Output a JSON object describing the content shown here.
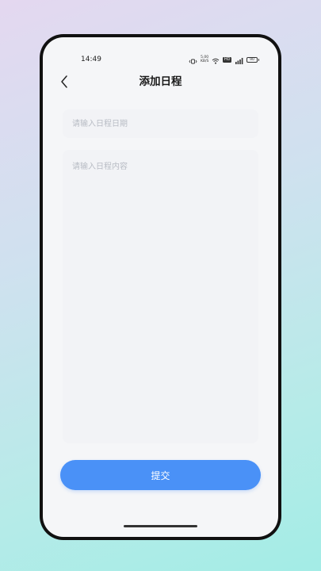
{
  "status_bar": {
    "time": "14:49",
    "net_speed_value": "5.00",
    "net_speed_unit": "KB/S",
    "hd_label": "HD",
    "battery_level": "90",
    "icons": [
      "vibrate-icon",
      "wifi-icon",
      "hd-icon",
      "signal-icon",
      "battery-icon"
    ]
  },
  "header": {
    "title": "添加日程",
    "back_icon": "chevron-left-icon"
  },
  "form": {
    "date_placeholder": "请输入日程日期",
    "date_value": "",
    "content_placeholder": "请输入日程内容",
    "content_value": "",
    "submit_label": "提交"
  },
  "colors": {
    "accent": "#4a91f7",
    "field_background": "#f2f3f6",
    "screen_background": "#f5f6f8"
  }
}
